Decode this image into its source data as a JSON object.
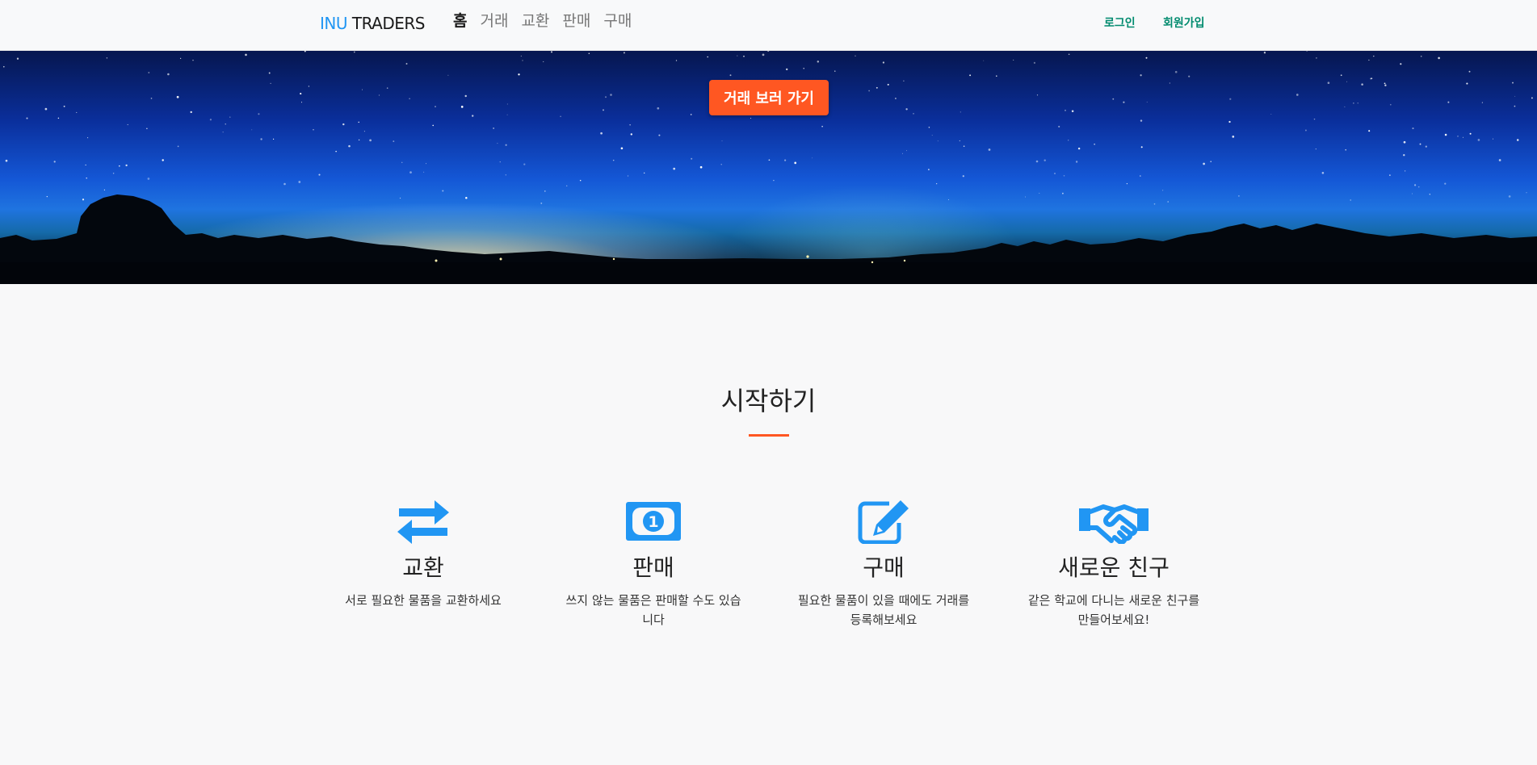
{
  "navbar": {
    "brand_part1": "INU",
    "brand_part2": " TRADERS",
    "links": [
      {
        "label": "홈",
        "active": true
      },
      {
        "label": "거래",
        "active": false
      },
      {
        "label": "교환",
        "active": false
      },
      {
        "label": "판매",
        "active": false
      },
      {
        "label": "구매",
        "active": false
      }
    ],
    "login_label": "로그인",
    "signup_label": "회원가입"
  },
  "hero": {
    "button_label": "거래 보러 가기"
  },
  "section": {
    "title": "시작하기"
  },
  "features": [
    {
      "icon": "exchange-arrows-icon",
      "title": "교환",
      "description": "서로 필요한 물품을 교환하세요"
    },
    {
      "icon": "money-bill-icon",
      "title": "판매",
      "description": "쓰지 않는 물품은 판매할 수도 있습니다"
    },
    {
      "icon": "edit-pencil-icon",
      "title": "구매",
      "description": "필요한 물품이 있을 때에도 거래를 등록해보세요"
    },
    {
      "icon": "handshake-icon",
      "title": "새로운 친구",
      "description": "같은 학교에 다니는 새로운 친구를 만들어보세요!"
    }
  ],
  "colors": {
    "brand_blue": "#2196f3",
    "accent_orange": "#ff5722",
    "auth_green": "#008b6e",
    "icon_blue": "#2196f3"
  }
}
